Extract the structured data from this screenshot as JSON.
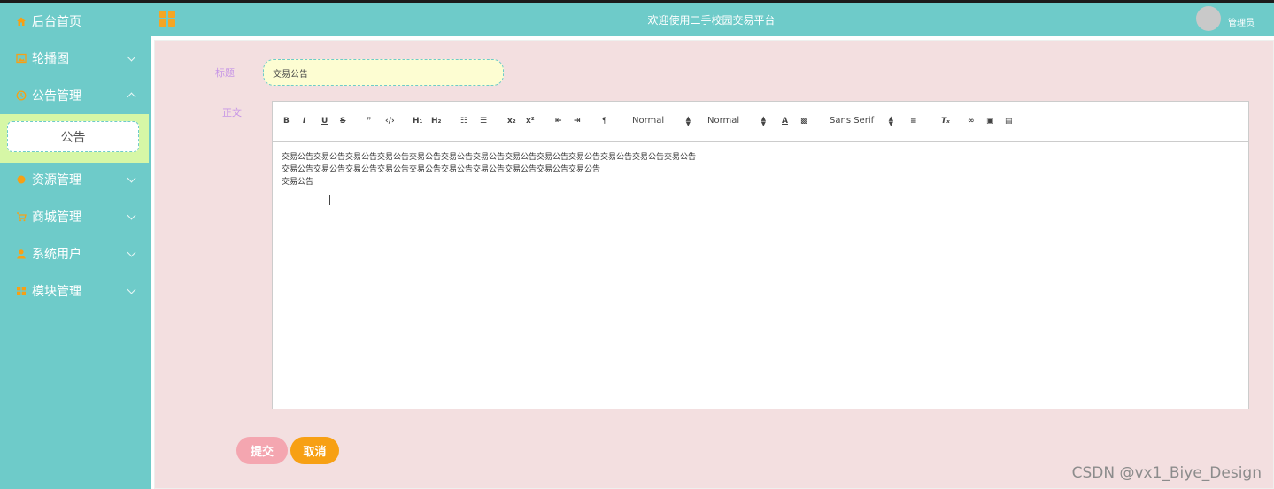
{
  "header": {
    "title": "欢迎使用二手校园交易平台",
    "user": "管理员"
  },
  "sidebar": {
    "items": [
      {
        "label": "后台首页",
        "icon": "home-icon"
      },
      {
        "label": "轮播图",
        "icon": "image-icon"
      },
      {
        "label": "公告管理",
        "icon": "clock-icon"
      },
      {
        "label": "资源管理",
        "icon": "dot-icon"
      },
      {
        "label": "商城管理",
        "icon": "cart-icon"
      },
      {
        "label": "系统用户",
        "icon": "user-icon"
      },
      {
        "label": "模块管理",
        "icon": "grid-icon"
      }
    ],
    "active_sub": "公告"
  },
  "form": {
    "title_label": "标题",
    "title_value": "交易公告",
    "body_label": "正文",
    "submit_label": "提交",
    "cancel_label": "取消"
  },
  "editor": {
    "toolbar": {
      "header_select": "Normal",
      "size_select": "Normal",
      "font_select": "Sans Serif"
    },
    "lines": [
      "交易公告交易公告交易公告交易公告交易公告交易公告交易公告交易公告交易公告交易公告交易公告交易公告交易公告",
      "交易公告交易公告交易公告交易公告交易公告交易公告交易公告交易公告交易公告交易公告",
      "交易公告"
    ]
  },
  "watermark": "CSDN @vx1_Biye_Design",
  "colors": {
    "teal": "#6ecbc9",
    "orange": "#f7a014",
    "pink_bg": "#f3dfe0",
    "label_purple": "#c796e6",
    "submit_pink": "#f4a6b0"
  }
}
